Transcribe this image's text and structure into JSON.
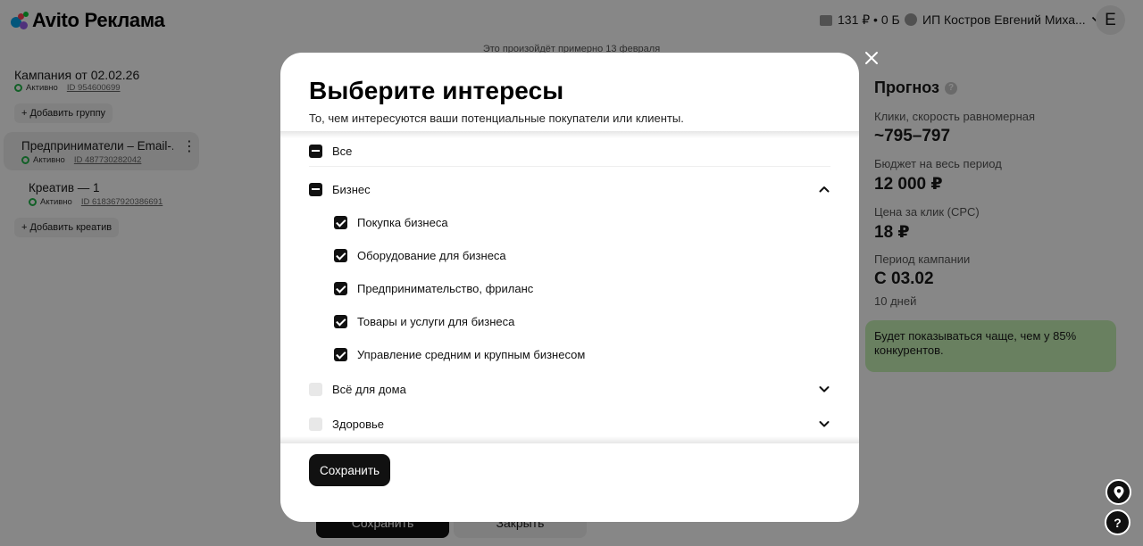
{
  "header": {
    "brand": "Avito Реклама",
    "balance": "131 ₽ • 0 Б",
    "account_name": "ИП Костров Евгений Миха...",
    "avatar_letter": "Е"
  },
  "hint_text": "Это произойдёт примерно 13 февраля",
  "sidebar": {
    "campaign_title": "Кампания от 02.02.26",
    "campaign_status": "Активно",
    "campaign_id": "ID 954600699",
    "add_group": "Добавить группу",
    "group_title": "Предприниматели – Email-...",
    "group_status": "Активно",
    "group_id": "ID 487730282042",
    "creative_title": "Креатив — 1",
    "creative_status": "Активно",
    "creative_id": "ID 618367920386691",
    "add_creative": "Добавить креатив"
  },
  "forecast": {
    "title": "Прогноз",
    "clicks_label": "Клики, скорость равномерная",
    "clicks_value": "~795–797",
    "budget_label": "Бюджет на весь период",
    "budget_value": "12 000 ₽",
    "cpc_label": "Цена за клик (CPC)",
    "cpc_value": "18 ₽",
    "period_label": "Период кампании",
    "period_value": "С 03.02",
    "period_days": "10 дней",
    "note": "Будет показываться чаще, чем у 85% конкурентов."
  },
  "footer": {
    "save": "Сохранить",
    "close": "Закрыть"
  },
  "modal": {
    "title": "Выберите интересы",
    "subtitle": "То, чем интересуются ваши потенциальные покупатели или клиенты.",
    "items": [
      {
        "label": "Все",
        "state": "indeterminate"
      },
      {
        "label": "Бизнес",
        "state": "indeterminate",
        "expanded": true
      },
      {
        "label": "Покупка бизнеса",
        "state": "checked"
      },
      {
        "label": "Оборудование для бизнеса",
        "state": "checked"
      },
      {
        "label": "Предпринимательство, фриланс",
        "state": "checked"
      },
      {
        "label": "Товары и услуги для бизнеса",
        "state": "checked"
      },
      {
        "label": "Управление средним и крупным бизнесом",
        "state": "checked"
      },
      {
        "label": "Всё для дома",
        "state": "unchecked",
        "expanded": false
      },
      {
        "label": "Здоровье",
        "state": "unchecked",
        "expanded": false
      }
    ],
    "save_label": "Сохранить"
  },
  "colors": {
    "accent_green": "#22b64a",
    "note_bg": "#c6f2b6",
    "primary_button": "#111111"
  }
}
